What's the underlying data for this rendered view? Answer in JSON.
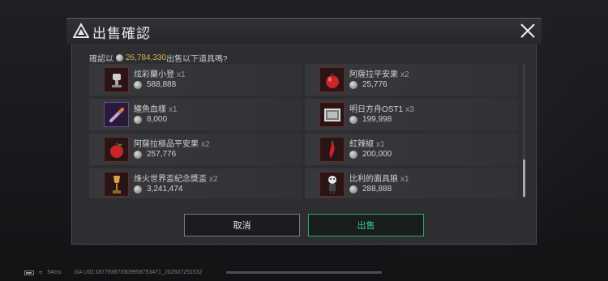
{
  "dialog": {
    "title": "出售確認",
    "confirm_prefix": "確認以",
    "confirm_amount": "26,784,330",
    "confirm_suffix": "出售以下道具嗎?",
    "cancel_label": "取消",
    "sell_label": "出售"
  },
  "items": [
    {
      "name": "炫彩蘭小登",
      "qty": "x1",
      "price": "588,888",
      "icon": "trophy-icon"
    },
    {
      "name": "阿薩拉平安果",
      "qty": "x2",
      "price": "25,776",
      "icon": "apple-icon"
    },
    {
      "name": "鱷魚血樣",
      "qty": "x1",
      "price": "8,000",
      "icon": "vial-icon"
    },
    {
      "name": "明日方舟OST1",
      "qty": "x3",
      "price": "199,998",
      "icon": "album-icon"
    },
    {
      "name": "阿薩拉極品平安果",
      "qty": "x2",
      "price": "257,776",
      "icon": "apple-icon"
    },
    {
      "name": "紅辣椒",
      "qty": "x1",
      "price": "200,000",
      "icon": "chili-icon"
    },
    {
      "name": "烽火世界盃紀念獎盃",
      "qty": "x2",
      "price": "3,241,474",
      "icon": "cup-icon"
    },
    {
      "name": "比利的面具狼",
      "qty": "x1",
      "price": "288,888",
      "icon": "figure-icon"
    }
  ],
  "status": {
    "ping": "54ms",
    "uid": "GA UID:187793873309958753471_202607251532"
  },
  "colors": {
    "accent_gold": "#d6b54a",
    "sell_green": "#33d17f"
  }
}
